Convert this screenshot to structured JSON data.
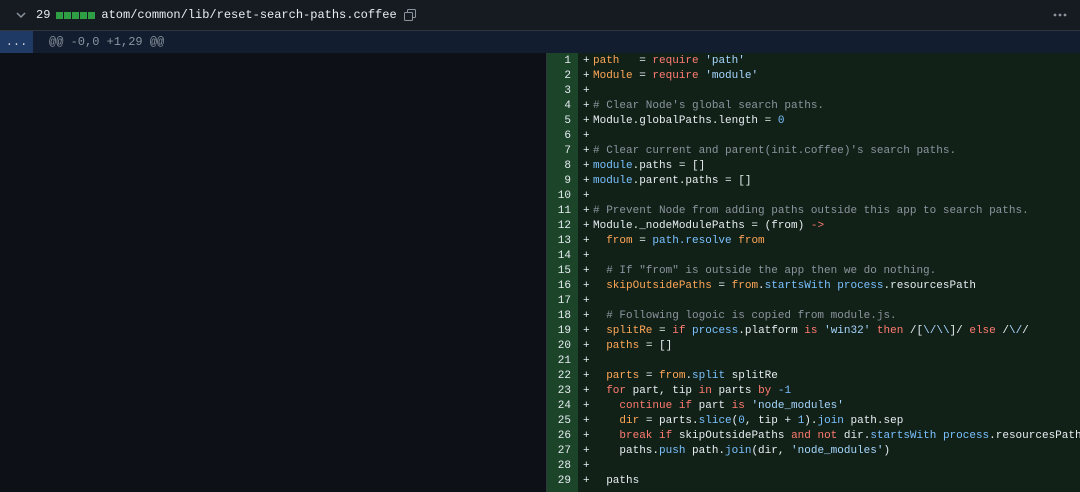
{
  "header": {
    "count": "29",
    "filename": "atom/common/lib/reset-search-paths.coffee",
    "colors": {
      "additions": "#2ea043"
    }
  },
  "hunk": {
    "expand_label": "...",
    "header": "@@ -0,0 +1,29 @@"
  },
  "lines": [
    {
      "n": "1",
      "sign": "+",
      "tokens": [
        {
          "t": "path",
          "c": "var"
        },
        {
          "t": "   = "
        },
        {
          "t": "require",
          "c": "kw"
        },
        {
          "t": " "
        },
        {
          "t": "'path'",
          "c": "str"
        }
      ]
    },
    {
      "n": "2",
      "sign": "+",
      "tokens": [
        {
          "t": "Module",
          "c": "var"
        },
        {
          "t": " = "
        },
        {
          "t": "require",
          "c": "kw"
        },
        {
          "t": " "
        },
        {
          "t": "'module'",
          "c": "str"
        }
      ]
    },
    {
      "n": "3",
      "sign": "+",
      "tokens": []
    },
    {
      "n": "4",
      "sign": "+",
      "tokens": [
        {
          "t": "# Clear Node's global search paths.",
          "c": "com"
        }
      ]
    },
    {
      "n": "5",
      "sign": "+",
      "tokens": [
        {
          "t": "Module.globalPaths.length = "
        },
        {
          "t": "0",
          "c": "num"
        }
      ]
    },
    {
      "n": "6",
      "sign": "+",
      "tokens": []
    },
    {
      "n": "7",
      "sign": "+",
      "tokens": [
        {
          "t": "# Clear current and parent(init.coffee)'s search paths.",
          "c": "com"
        }
      ]
    },
    {
      "n": "8",
      "sign": "+",
      "tokens": [
        {
          "t": "module",
          "c": "prop"
        },
        {
          "t": ".paths = []"
        }
      ]
    },
    {
      "n": "9",
      "sign": "+",
      "tokens": [
        {
          "t": "module",
          "c": "prop"
        },
        {
          "t": ".parent.paths = []"
        }
      ]
    },
    {
      "n": "10",
      "sign": "+",
      "tokens": []
    },
    {
      "n": "11",
      "sign": "+",
      "tokens": [
        {
          "t": "# Prevent Node from adding paths outside this app to search paths.",
          "c": "com"
        }
      ]
    },
    {
      "n": "12",
      "sign": "+",
      "tokens": [
        {
          "t": "Module._nodeModulePaths = (from) "
        },
        {
          "t": "->",
          "c": "kw"
        }
      ]
    },
    {
      "n": "13",
      "sign": "+",
      "tokens": [
        {
          "t": "  "
        },
        {
          "t": "from",
          "c": "var"
        },
        {
          "t": " = "
        },
        {
          "t": "path.resolve",
          "c": "prop"
        },
        {
          "t": " "
        },
        {
          "t": "from",
          "c": "var"
        }
      ]
    },
    {
      "n": "14",
      "sign": "+",
      "tokens": []
    },
    {
      "n": "15",
      "sign": "+",
      "tokens": [
        {
          "t": "  # If \"from\" is outside the app then we do nothing.",
          "c": "com"
        }
      ]
    },
    {
      "n": "16",
      "sign": "+",
      "tokens": [
        {
          "t": "  "
        },
        {
          "t": "skipOutsidePaths",
          "c": "var"
        },
        {
          "t": " = "
        },
        {
          "t": "from",
          "c": "var"
        },
        {
          "t": "."
        },
        {
          "t": "startsWith",
          "c": "prop"
        },
        {
          "t": " "
        },
        {
          "t": "process",
          "c": "prop"
        },
        {
          "t": ".resourcesPath"
        }
      ]
    },
    {
      "n": "17",
      "sign": "+",
      "tokens": []
    },
    {
      "n": "18",
      "sign": "+",
      "tokens": [
        {
          "t": "  # Following logoic is copied from module.js.",
          "c": "com"
        }
      ]
    },
    {
      "n": "19",
      "sign": "+",
      "tokens": [
        {
          "t": "  "
        },
        {
          "t": "splitRe",
          "c": "var"
        },
        {
          "t": " = "
        },
        {
          "t": "if",
          "c": "kw"
        },
        {
          "t": " "
        },
        {
          "t": "process",
          "c": "prop"
        },
        {
          "t": ".platform "
        },
        {
          "t": "is",
          "c": "kw"
        },
        {
          "t": " "
        },
        {
          "t": "'win32'",
          "c": "str"
        },
        {
          "t": " "
        },
        {
          "t": "then",
          "c": "kw"
        },
        {
          "t": " /["
        },
        {
          "t": "\\/\\\\",
          "c": "str"
        },
        {
          "t": "]/ "
        },
        {
          "t": "else",
          "c": "kw"
        },
        {
          "t": " /"
        },
        {
          "t": "\\/",
          "c": "str"
        },
        {
          "t": "/"
        }
      ]
    },
    {
      "n": "20",
      "sign": "+",
      "tokens": [
        {
          "t": "  "
        },
        {
          "t": "paths",
          "c": "var"
        },
        {
          "t": " = []"
        }
      ]
    },
    {
      "n": "21",
      "sign": "+",
      "tokens": []
    },
    {
      "n": "22",
      "sign": "+",
      "tokens": [
        {
          "t": "  "
        },
        {
          "t": "parts",
          "c": "var"
        },
        {
          "t": " = "
        },
        {
          "t": "from",
          "c": "var"
        },
        {
          "t": "."
        },
        {
          "t": "split",
          "c": "prop"
        },
        {
          "t": " splitRe"
        }
      ]
    },
    {
      "n": "23",
      "sign": "+",
      "tokens": [
        {
          "t": "  "
        },
        {
          "t": "for",
          "c": "kw"
        },
        {
          "t": " part, tip "
        },
        {
          "t": "in",
          "c": "kw"
        },
        {
          "t": " parts "
        },
        {
          "t": "by",
          "c": "kw"
        },
        {
          "t": " "
        },
        {
          "t": "-1",
          "c": "num"
        }
      ]
    },
    {
      "n": "24",
      "sign": "+",
      "tokens": [
        {
          "t": "    "
        },
        {
          "t": "continue",
          "c": "kw"
        },
        {
          "t": " "
        },
        {
          "t": "if",
          "c": "kw"
        },
        {
          "t": " part "
        },
        {
          "t": "is",
          "c": "kw"
        },
        {
          "t": " "
        },
        {
          "t": "'node_modules'",
          "c": "str"
        }
      ]
    },
    {
      "n": "25",
      "sign": "+",
      "tokens": [
        {
          "t": "    "
        },
        {
          "t": "dir",
          "c": "var"
        },
        {
          "t": " = parts."
        },
        {
          "t": "slice",
          "c": "prop"
        },
        {
          "t": "("
        },
        {
          "t": "0",
          "c": "num"
        },
        {
          "t": ", tip + "
        },
        {
          "t": "1",
          "c": "num"
        },
        {
          "t": ")."
        },
        {
          "t": "join",
          "c": "prop"
        },
        {
          "t": " path.sep"
        }
      ]
    },
    {
      "n": "26",
      "sign": "+",
      "tokens": [
        {
          "t": "    "
        },
        {
          "t": "break",
          "c": "kw"
        },
        {
          "t": " "
        },
        {
          "t": "if",
          "c": "kw"
        },
        {
          "t": " skipOutsidePaths "
        },
        {
          "t": "and",
          "c": "kw"
        },
        {
          "t": " "
        },
        {
          "t": "not",
          "c": "kw"
        },
        {
          "t": " dir."
        },
        {
          "t": "startsWith",
          "c": "prop"
        },
        {
          "t": " "
        },
        {
          "t": "process",
          "c": "prop"
        },
        {
          "t": ".resourcesPath"
        }
      ]
    },
    {
      "n": "27",
      "sign": "+",
      "tokens": [
        {
          "t": "    paths."
        },
        {
          "t": "push",
          "c": "prop"
        },
        {
          "t": " path."
        },
        {
          "t": "join",
          "c": "prop"
        },
        {
          "t": "(dir, "
        },
        {
          "t": "'node_modules'",
          "c": "str"
        },
        {
          "t": ")"
        }
      ]
    },
    {
      "n": "28",
      "sign": "+",
      "tokens": []
    },
    {
      "n": "29",
      "sign": "+",
      "tokens": [
        {
          "t": "  paths"
        }
      ]
    }
  ]
}
